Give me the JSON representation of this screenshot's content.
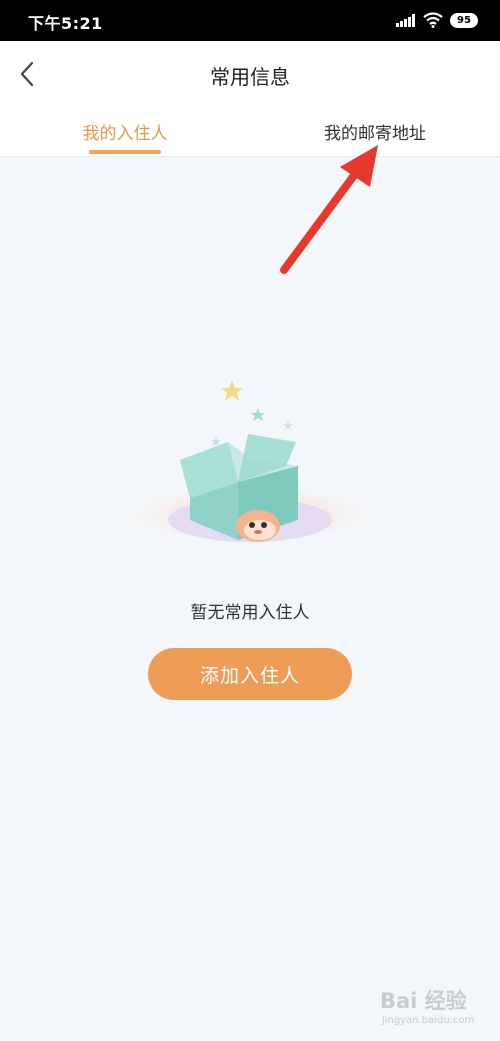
{
  "status_bar": {
    "time": "下午5:21",
    "battery": "95"
  },
  "header": {
    "title": "常用信息",
    "back_icon": "chevron-left-icon"
  },
  "tabs": [
    {
      "label": "我的入住人",
      "active": true
    },
    {
      "label": "我的邮寄地址",
      "active": false
    }
  ],
  "empty_state": {
    "illustration": "empty-box-illustration",
    "message": "暂无常用入住人",
    "button_label": "添加入住人"
  },
  "colors": {
    "accent": "#ef9c57",
    "active_tab": "#e49a4b",
    "arrow": "#e8382d"
  },
  "watermark": {
    "main": "Bai 经验",
    "sub": "jingyan.baidu.com"
  }
}
